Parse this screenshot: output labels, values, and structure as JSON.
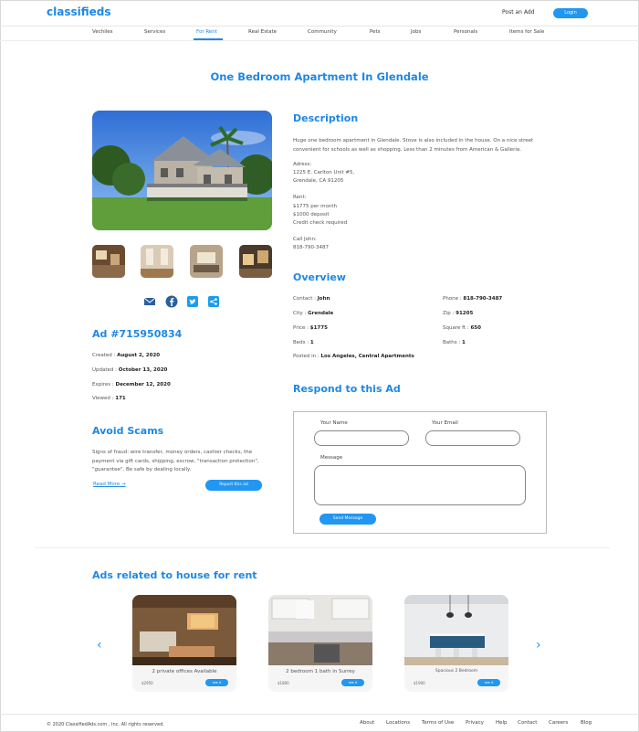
{
  "header": {
    "logo": "classifieds",
    "post_add": "Post an Add",
    "login": "Login"
  },
  "nav": [
    "Vechiles",
    "Services",
    "For Rent",
    "Real Estate",
    "Community",
    "Pets",
    "Jobs",
    "Personals",
    "Items for Sale"
  ],
  "nav_active_index": 2,
  "title": "One Bedroom Apartment In Glendale",
  "ad": {
    "heading": "Ad #715950834",
    "created_label": "Created :",
    "created": "August 2, 2020",
    "updated_label": "Updated :",
    "updated": "October 13, 2020",
    "expires_label": "Expires :",
    "expires": "December 12, 2020",
    "viewed_label": "Viewed :",
    "viewed": "171"
  },
  "scams": {
    "heading": "Avoid Scams",
    "text": "Signs of fraud: wire transfer, money orders, cashier checks, the payment via gift cards, shipping, escrow, \"transaction protection\", \"guarantee\". Be safe by dealing locally.",
    "read_more": "Read More →",
    "report": "Report this ad"
  },
  "description": {
    "heading": "Description",
    "intro": "Huge one bedroom apartment in Glendale. Stove is also included in the house. On a nice street convenient for schools as well as shopping. Less than 2 minutes from American & Galleria.",
    "address_label": "Adress:",
    "address_line1": "1225 E. Carlton Unit #5,",
    "address_line2": "Grendale, CA 91205",
    "rent_label": "Rent:",
    "rent_line1": "$1775 per month",
    "rent_line2": "$1000 deposit",
    "rent_line3": "Credit check required",
    "call_label": "Call John:",
    "call_phone": "818-790-3487"
  },
  "overview": {
    "heading": "Overview",
    "contact_label": "Contact :",
    "contact": "John",
    "phone_label": "Phone :",
    "phone": "818-790-3487",
    "city_label": "City :",
    "city": "Grendale",
    "zip_label": "Zip :",
    "zip": "91205",
    "price_label": "Price :",
    "price": "$1775",
    "sqft_label": "Square ft :",
    "sqft": "650",
    "beds_label": "Beds :",
    "beds": "1",
    "baths_label": "Baths :",
    "baths": "1",
    "posted_label": "Posted in :",
    "posted": "Los Angeles, Central Apartments"
  },
  "respond": {
    "heading": "Respond to this Ad",
    "name_label": "Your Name",
    "email_label": "Your Email",
    "message_label": "Message",
    "send": "Send Message"
  },
  "related": {
    "heading": "Ads related to house for rent",
    "cards": [
      {
        "title": "2 private offices Available",
        "price": "$2950",
        "btn": "see it"
      },
      {
        "title": "2 bedroom 1 bath in Surrey",
        "price": "$1800",
        "btn": "see it"
      },
      {
        "title": "Spacious 2 Bedroom",
        "price": "$1900",
        "btn": "see it"
      }
    ]
  },
  "footer": {
    "copyright": "© 2020 ClassifiedAds.com , Inc. All rights reserved.",
    "links": [
      "About",
      "Locations",
      "Terms of Use",
      "Privacy",
      "Help",
      "Contact",
      "Careers",
      "Blog"
    ]
  },
  "colors": {
    "accent": "#1e88e5",
    "button": "#2196f3"
  },
  "icons": [
    "mail-icon",
    "facebook-icon",
    "twitter-icon",
    "share-icon",
    "chevron-left-icon",
    "chevron-right-icon"
  ]
}
